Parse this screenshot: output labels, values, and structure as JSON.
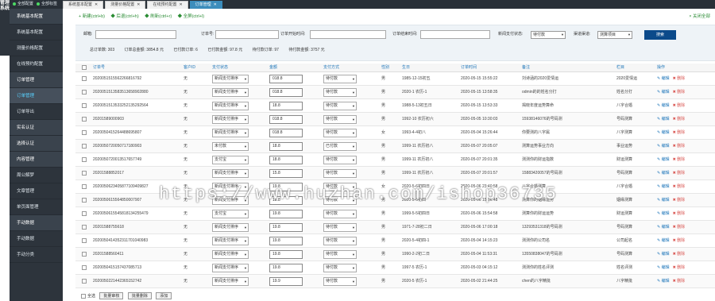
{
  "brand": "管理系统",
  "topbar": {
    "link1": "全部配置",
    "link2": "全部标签"
  },
  "tabs": [
    {
      "label": "系统基本配置",
      "active": false
    },
    {
      "label": "测量价格配置",
      "active": false
    },
    {
      "label": "在线预约配置",
      "active": false
    },
    {
      "label": "订单管理",
      "active": true
    }
  ],
  "sidebar": [
    {
      "label": "系统基本配置",
      "type": "grp"
    },
    {
      "label": "系统基本配置",
      "type": "item"
    },
    {
      "label": "测量价格配置",
      "type": "item"
    },
    {
      "label": "在线预约配置",
      "type": "item"
    },
    {
      "label": "订单管理",
      "type": "grp"
    },
    {
      "label": "订单管理",
      "type": "sel"
    },
    {
      "label": "订单导出",
      "type": "item"
    },
    {
      "label": "实名认证",
      "type": "grp"
    },
    {
      "label": "选择认证",
      "type": "grp"
    },
    {
      "label": "内容管理",
      "type": "grp"
    },
    {
      "label": "周公解梦",
      "type": "item"
    },
    {
      "label": "文章管理",
      "type": "item"
    },
    {
      "label": "单页面管理",
      "type": "item"
    },
    {
      "label": "手动数据",
      "type": "grp"
    },
    {
      "label": "手动数据",
      "type": "item"
    },
    {
      "label": "手动分类",
      "type": "item"
    }
  ],
  "toolbar": {
    "add": "+ 新建(ctrl+b)",
    "back": "◆ 后退(ctrl+h)",
    "refresh": "◆ 刷新(ctrl+r)",
    "fullscreen": "◆ 全屏(ctrl+l)",
    "close_all": "× 关闭全部"
  },
  "filter": {
    "email_label": "邮箱:",
    "order_no_label": "订单号:",
    "time_start_label": "订单开始时间:",
    "time_end_label": "订单结束时间:",
    "pay_status_label": "新闻支付状态:",
    "pay_status_value": "待付款",
    "channel_label": "渠道渠道:",
    "channel_value": "测算项目",
    "search": "搜索"
  },
  "stats": {
    "total": "总订单数: 303",
    "amount": "订单总金额: 3854.8 元",
    "paid_orders": "已付款订单: 6",
    "paid_amount": "已付款金额: 97.8 元",
    "unpaid_orders": "待付款订单: 97",
    "unpaid_amount": "待付款金额: 3757 元"
  },
  "columns": [
    "订单号",
    "客户ID",
    "支付状态",
    "金额",
    "支付方式",
    "性别",
    "生日",
    "订单时间",
    "备注",
    "栏目",
    "操作"
  ],
  "rows": [
    {
      "order_no": "2020051515562266816792",
      "cid": "无",
      "pay": "新闻支付排序",
      "amount": "018.8",
      "method": "待付款",
      "sex": "男",
      "birth": "1985-12-15初五",
      "time": "2020-05-15 15:55:22",
      "note": "刘诗涵的2020爱情运",
      "col": "2020爱情运"
    },
    {
      "order_no": "2020051513583513658902880",
      "cid": "无",
      "pay": "新闻支付排序",
      "amount": "018.8",
      "method": "待付款",
      "sex": "男",
      "birth": "2020-1 农历-1",
      "time": "2020-05-15 13:58:35",
      "note": "odmin的的姓名分打",
      "col": "姓名分打"
    },
    {
      "order_no": "2020051513533252135292564",
      "cid": "无",
      "pay": "新闻支付排序",
      "amount": "18.8",
      "method": "待付款",
      "sex": "男",
      "birth": "1988-5-13初五日",
      "time": "2020-05-15 13:53:33",
      "note": "揭晓年度运势算命",
      "col": "八字合婚"
    },
    {
      "order_no": "20201589000903",
      "cid": "无",
      "pay": "新闻支付排序",
      "amount": "018.8",
      "method": "待付款",
      "sex": "男",
      "birth": "1992-10 农历初六",
      "time": "2020-05-05 10:30:03",
      "note": "15938146076的号码测",
      "col": "号码测算"
    },
    {
      "order_no": "2020050415264488695807",
      "cid": "无",
      "pay": "新闻支付排序",
      "amount": "018.8",
      "method": "待付款",
      "sex": "女",
      "birth": "1993-4-4初八",
      "time": "2020-05-04 15:26:44",
      "note": "你要测的八字属",
      "col": "八字测算"
    },
    {
      "order_no": "2020050720050717180903",
      "cid": "无",
      "pay": "未付款",
      "amount": "18.8",
      "method": "已付款",
      "sex": "男",
      "birth": "1999-11 农历初八",
      "time": "2020-05-07 20:05:07",
      "note": "测算运势事业方向",
      "col": "事业运势"
    },
    {
      "order_no": "2020050720013517657749",
      "cid": "无",
      "pay": "支付宝",
      "amount": "18.8",
      "method": "待付款",
      "sex": "男",
      "birth": "1999-11 农历初八",
      "time": "2020-05-07 20:01:35",
      "note": "测测你的财运指数",
      "col": "财运测算"
    },
    {
      "order_no": "20201588852017",
      "cid": "无",
      "pay": "新闻支付排序",
      "amount": "15.8",
      "method": "待付款",
      "sex": "男",
      "birth": "1999-11 农历初八",
      "time": "2020-05-07 20:01:57",
      "note": "15883420057的号码测",
      "col": "号码测算"
    },
    {
      "order_no": "2020050623405877109409827",
      "cid": "无",
      "pay": "新闻支付排序",
      "amount": "19.8",
      "method": "待付款",
      "sex": "女",
      "birth": "2020-5-6初四日",
      "time": "2020-05-06 23:40:58",
      "note": "八字合婚测算",
      "col": "八字合婚"
    },
    {
      "order_no": "2020050615564850007907",
      "cid": "无",
      "pay": "新闻支付排序",
      "amount": "18.8",
      "method": "待付款",
      "sex": "男",
      "birth": "2020-5-6初四",
      "time": "2020-05-06 15:56:48",
      "note": "测算你的姻缘运势",
      "col": "姻缘测算"
    },
    {
      "order_no": "2020050615545818134255479",
      "cid": "无",
      "pay": "支付宝",
      "amount": "19.8",
      "method": "待付款",
      "sex": "男",
      "birth": "1999-5-5初四日",
      "time": "2020-05-06 15:54:58",
      "note": "测算你的财运运势",
      "col": "财运测算"
    },
    {
      "order_no": "20201588755618",
      "cid": "无",
      "pay": "新闻支付排序",
      "amount": "19.8",
      "method": "待付款",
      "sex": "男",
      "birth": "1971-7-28初二日",
      "time": "2020-05-06 17:00:18",
      "note": "13293531318的号码测",
      "col": "号码测算"
    },
    {
      "order_no": "2020050414352311701040983",
      "cid": "无",
      "pay": "新闻支付排序",
      "amount": "19.8",
      "method": "待付款",
      "sex": "男",
      "birth": "2020-5-4初四-1",
      "time": "2020-05-04 14:15:23",
      "note": "测测你的公司名",
      "col": "公司起名"
    },
    {
      "order_no": "20201588560411",
      "cid": "无",
      "pay": "新闻支付排序",
      "amount": "19.8",
      "method": "待付款",
      "sex": "男",
      "birth": "1990-2-2初二日",
      "time": "2020-05-04 11:53:31",
      "note": "13550838047的号码测",
      "col": "号码测算"
    },
    {
      "order_no": "2020050415157437085713",
      "cid": "无",
      "pay": "新闻支付排序",
      "amount": "19.8",
      "method": "待付款",
      "sex": "男",
      "birth": "1997-5 农历-1",
      "time": "2020-05-03 04:15:12",
      "note": "测测你的姓名评测",
      "col": "姓名评测"
    },
    {
      "order_no": "2020050221442365152742",
      "cid": "无",
      "pay": "新闻支付排序",
      "amount": "19.9",
      "method": "待付款",
      "sex": "男",
      "birth": "2020-5 农历-1",
      "time": "2020-05-02 21:44:25",
      "note": "chen的八字精批",
      "col": "八字精批"
    }
  ],
  "row_actions": {
    "edit": "✎ 编辑",
    "delete": "✖ 删除"
  },
  "footer": {
    "select_all": "全选",
    "batch_audit": "批量审核",
    "batch_delete": "批量删除",
    "add": "添加"
  },
  "watermark": "https://www.huzhan.com/ishop36735"
}
